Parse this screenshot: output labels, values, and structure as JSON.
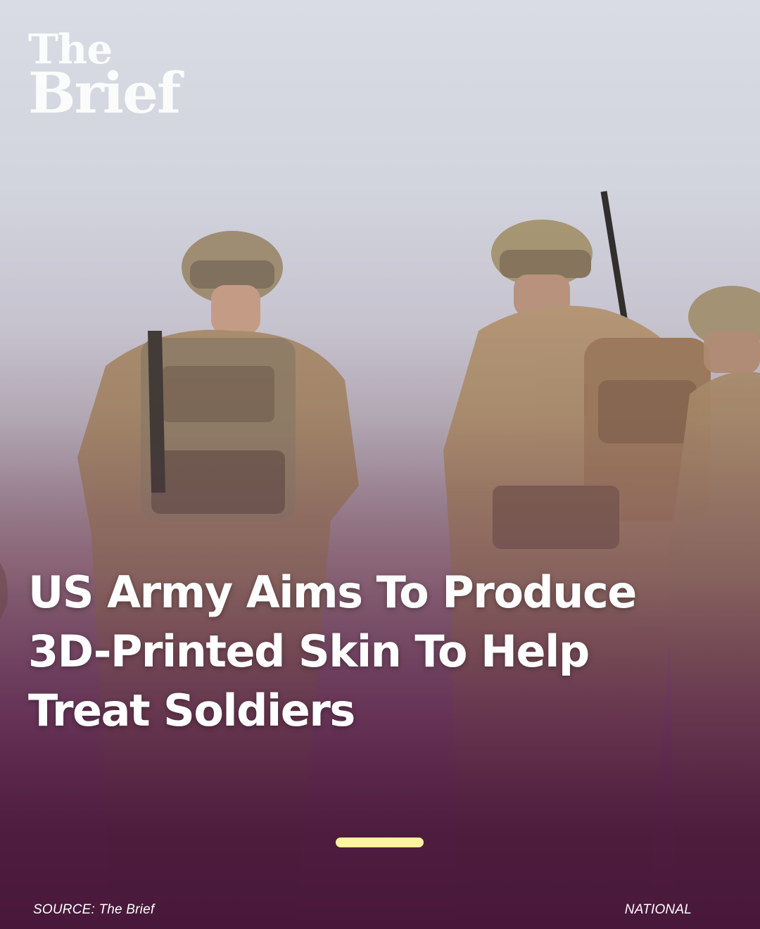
{
  "brand": {
    "line1": "The",
    "line2": "Brief"
  },
  "article": {
    "headline": "US Army Aims To Produce 3D-Printed Skin To Help Treat Soldiers"
  },
  "pager": {
    "active_color": "#fff3a0"
  },
  "footer": {
    "source": "SOURCE: The Brief",
    "category": "NATIONAL"
  },
  "colors": {
    "overlay": "#4b1a3c",
    "headline_text": "#ffffff"
  }
}
